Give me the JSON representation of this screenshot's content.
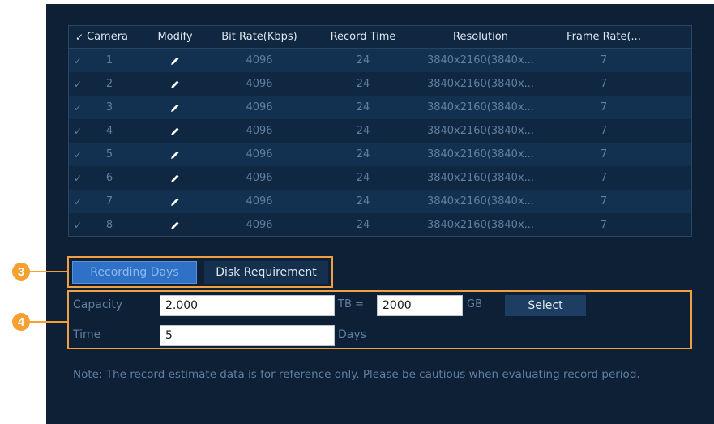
{
  "table": {
    "check_header": "✓",
    "headers": {
      "camera": "Camera",
      "modify": "Modify",
      "bitrate": "Bit Rate(Kbps)",
      "record_time": "Record Time",
      "resolution": "Resolution",
      "frame_rate": "Frame Rate(..."
    },
    "rows": [
      {
        "check": "✓",
        "camera": "1",
        "bitrate": "4096",
        "record_time": "24",
        "resolution": "3840x2160(3840x...",
        "frame_rate": "7"
      },
      {
        "check": "✓",
        "camera": "2",
        "bitrate": "4096",
        "record_time": "24",
        "resolution": "3840x2160(3840x...",
        "frame_rate": "7"
      },
      {
        "check": "✓",
        "camera": "3",
        "bitrate": "4096",
        "record_time": "24",
        "resolution": "3840x2160(3840x...",
        "frame_rate": "7"
      },
      {
        "check": "✓",
        "camera": "4",
        "bitrate": "4096",
        "record_time": "24",
        "resolution": "3840x2160(3840x...",
        "frame_rate": "7"
      },
      {
        "check": "✓",
        "camera": "5",
        "bitrate": "4096",
        "record_time": "24",
        "resolution": "3840x2160(3840x...",
        "frame_rate": "7"
      },
      {
        "check": "✓",
        "camera": "6",
        "bitrate": "4096",
        "record_time": "24",
        "resolution": "3840x2160(3840x...",
        "frame_rate": "7"
      },
      {
        "check": "✓",
        "camera": "7",
        "bitrate": "4096",
        "record_time": "24",
        "resolution": "3840x2160(3840x...",
        "frame_rate": "7"
      },
      {
        "check": "✓",
        "camera": "8",
        "bitrate": "4096",
        "record_time": "24",
        "resolution": "3840x2160(3840x...",
        "frame_rate": "7"
      }
    ]
  },
  "callouts": {
    "tabs_marker": "3",
    "fields_marker": "4"
  },
  "tabs": {
    "recording_days": "Recording Days",
    "disk_requirement": "Disk Requirement"
  },
  "form": {
    "capacity_label": "Capacity",
    "capacity_value": "2.000",
    "tb_label": "TB =",
    "gb_value": "2000",
    "gb_label": "GB",
    "select_label": "Select",
    "time_label": "Time",
    "time_value": "5",
    "days_label": "Days"
  },
  "note": "Note: The record estimate data is for reference only. Please be cautious when evaluating record period.",
  "colors": {
    "panel_bg": "#0d2036",
    "accent_blue": "#2f71c7",
    "callout_orange": "#f5a030"
  }
}
